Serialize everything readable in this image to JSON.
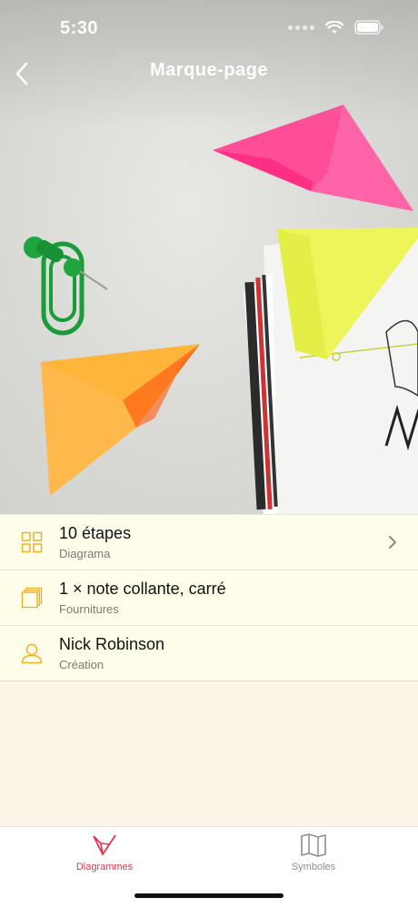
{
  "status_bar": {
    "time": "5:30"
  },
  "nav": {
    "title": "Marque-page",
    "back_icon": "chevron-left-icon"
  },
  "details": [
    {
      "primary": "10 étapes",
      "secondary": "Diagrama",
      "icon": "grid-icon",
      "has_chevron": true
    },
    {
      "primary": "1 × note collante, carré",
      "secondary": "Fournitures",
      "icon": "stacked-paper-icon",
      "has_chevron": false
    },
    {
      "primary": "Nick Robinson",
      "secondary": "Création",
      "icon": "person-icon",
      "has_chevron": false
    }
  ],
  "tabs": [
    {
      "label": "Diagrammes",
      "icon": "origami-fold-icon",
      "active": true
    },
    {
      "label": "Symboles",
      "icon": "map-icon",
      "active": false
    }
  ],
  "colors": {
    "accent": "#e8344a",
    "icon_yellow": "#e9b22c",
    "list_bg": "#fefdea",
    "page_bg": "#fcf4e6"
  }
}
